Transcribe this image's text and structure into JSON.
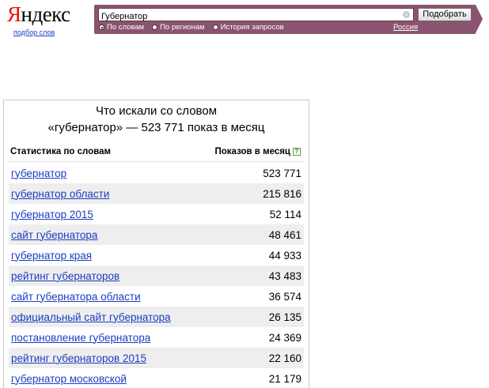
{
  "header": {
    "logo_first": "Я",
    "logo_rest": "ндекс",
    "sub_link": "подбор слов"
  },
  "search": {
    "query": "Губернатор",
    "button": "Подобрать",
    "clear_icon": "×",
    "radios": [
      {
        "label": "По словам",
        "checked": true
      },
      {
        "label": "По регионам",
        "checked": false
      },
      {
        "label": "История запросов",
        "checked": false
      }
    ],
    "region": "Россия"
  },
  "colors": {
    "search_bar": "#8a5470",
    "logo_accent": "#e61400",
    "link": "#1a3dc1",
    "row_stripe": "#eeeeee"
  },
  "results": {
    "title_line1": "Что искали со словом",
    "title_line2": "«губернатор» — 523 771 показ в месяц",
    "col_words": "Статистика по словам",
    "col_shows": "Показов в месяц",
    "help": "?",
    "rows": [
      {
        "phrase": "губернатор",
        "count": "523 771"
      },
      {
        "phrase": "губернатор области",
        "count": "215 816"
      },
      {
        "phrase": "губернатор 2015",
        "count": "52 114"
      },
      {
        "phrase": "сайт губернатора",
        "count": "48 461"
      },
      {
        "phrase": "губернатор края",
        "count": "44 933"
      },
      {
        "phrase": "рейтинг губернаторов",
        "count": "43 483"
      },
      {
        "phrase": "сайт губернатора области",
        "count": "36 574"
      },
      {
        "phrase": "официальный сайт губернатора",
        "count": "26 135"
      },
      {
        "phrase": "постановление губернатора",
        "count": "24 369"
      },
      {
        "phrase": "рейтинг губернаторов 2015",
        "count": "22 160"
      },
      {
        "phrase": "губернатор московской",
        "count": "21 179"
      }
    ]
  }
}
